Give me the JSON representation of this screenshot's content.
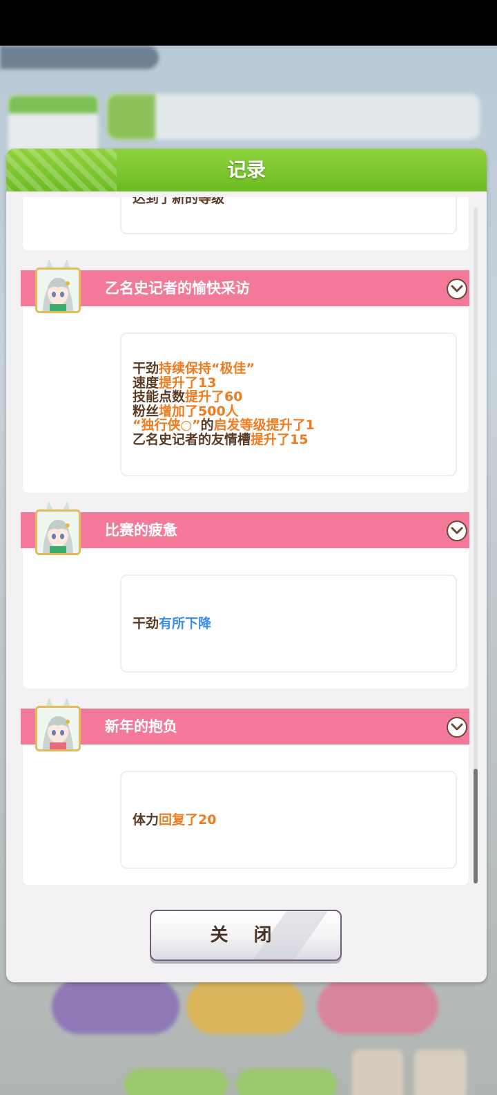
{
  "dialog": {
    "title": "记录",
    "close_label": "关 闭"
  },
  "partial_entry": {
    "text": "达到了新的等级"
  },
  "entries": [
    {
      "title": "乙名史记者的愉快采访",
      "lines": [
        [
          {
            "t": "干劲",
            "c": "k"
          },
          {
            "t": "持续保持“极佳”",
            "c": "o"
          }
        ],
        [
          {
            "t": "速度",
            "c": "k"
          },
          {
            "t": "提升了13",
            "c": "o"
          }
        ],
        [
          {
            "t": "技能点数",
            "c": "k"
          },
          {
            "t": "提升了60",
            "c": "o"
          }
        ],
        [
          {
            "t": "粉丝",
            "c": "k"
          },
          {
            "t": "增加了500人",
            "c": "o"
          }
        ],
        [
          {
            "t": "“独行侠○”",
            "c": "o"
          },
          {
            "t": "的",
            "c": "k"
          },
          {
            "t": "启发等级提升了1",
            "c": "o"
          }
        ],
        [
          {
            "t": "乙名史记者的友情槽",
            "c": "k"
          },
          {
            "t": "提升了15",
            "c": "o"
          }
        ]
      ]
    },
    {
      "title": "比赛的疲惫",
      "lines": [
        [
          {
            "t": "干劲",
            "c": "k"
          },
          {
            "t": "有所下降",
            "c": "b"
          }
        ]
      ]
    },
    {
      "title": "新年的抱负",
      "lines": [
        [
          {
            "t": "体力",
            "c": "k"
          },
          {
            "t": "回复了20",
            "c": "o"
          }
        ]
      ]
    }
  ],
  "icons": {
    "expand": "chevron-down-icon",
    "avatar": "character-avatar-icon"
  },
  "colors": {
    "header_green": "#7cc52f",
    "band_pink": "#f27a98",
    "text_dark": "#5a3a24",
    "text_orange": "#f07a1c",
    "text_blue": "#3b8ce6"
  }
}
